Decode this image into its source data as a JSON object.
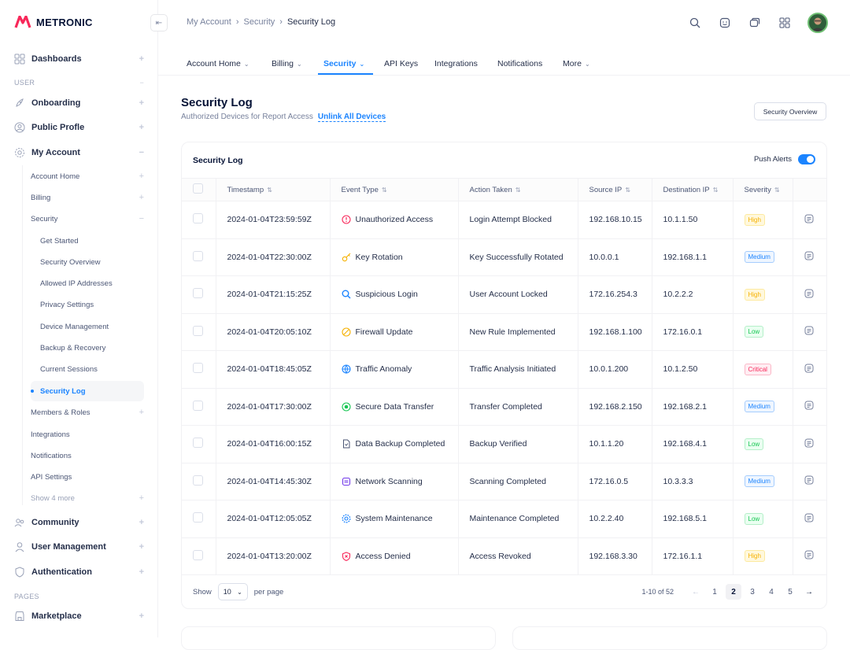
{
  "brand": {
    "name": "METRONIC",
    "accent": "#1b84ff",
    "logo_color": "#f8285a"
  },
  "sidebar": {
    "top": [
      {
        "label": "Dashboards",
        "icon": "grid-icon"
      }
    ],
    "group_user": "USER",
    "user_items": [
      {
        "label": "Onboarding",
        "icon": "rocket-icon"
      },
      {
        "label": "Public Profle",
        "icon": "user-circle-icon"
      },
      {
        "label": "My Account",
        "icon": "gear-icon"
      }
    ],
    "account_sub": [
      "Account Home",
      "Billing",
      "Security"
    ],
    "security_sub": [
      "Get Started",
      "Security Overview",
      "Allowed IP Addresses",
      "Privacy Settings",
      "Device Management",
      "Backup & Recovery",
      "Current Sessions",
      "Security Log"
    ],
    "account_sub2": [
      "Members & Roles",
      "Integrations",
      "Notifications",
      "API Settings",
      "Show 4 more"
    ],
    "more_items": [
      {
        "label": "Community",
        "icon": "users-icon"
      },
      {
        "label": "User Management",
        "icon": "user-icon"
      },
      {
        "label": "Authentication",
        "icon": "shield-icon"
      }
    ],
    "group_pages": "PAGES",
    "pages_items": [
      {
        "label": "Marketplace",
        "icon": "shop-icon"
      }
    ]
  },
  "breadcrumb": [
    "My Account",
    "Security",
    "Security Log"
  ],
  "tabs": [
    "Account Home",
    "Billing",
    "Security",
    "API Keys",
    "Integrations",
    "Notifications",
    "More"
  ],
  "page": {
    "title": "Security Log",
    "subtitle": "Authorized Devices for Report Access",
    "link": "Unlink All Devices",
    "overview_button": "Security Overview"
  },
  "card": {
    "title": "Security Log",
    "push_label": "Push Alerts",
    "columns": [
      "Timestamp",
      "Event Type",
      "Action Taken",
      "Source IP",
      "Destination IP",
      "Severity"
    ],
    "rows": [
      {
        "ts": "2024-01-04T23:59:59Z",
        "event": "Unauthorized Access",
        "icon": "alert-icon",
        "icolor": "#f8285a",
        "action": "Login Attempt Blocked",
        "src": "192.168.10.15",
        "dst": "10.1.1.50",
        "sev": "High"
      },
      {
        "ts": "2024-01-04T22:30:00Z",
        "event": "Key Rotation",
        "icon": "key-icon",
        "icolor": "#f6b100",
        "action": "Key Successfully Rotated",
        "src": "10.0.0.1",
        "dst": "192.168.1.1",
        "sev": "Medium"
      },
      {
        "ts": "2024-01-04T21:15:25Z",
        "event": "Suspicious Login",
        "icon": "search-icon",
        "icolor": "#1b84ff",
        "action": "User Account Locked",
        "src": "172.16.254.3",
        "dst": "10.2.2.2",
        "sev": "High"
      },
      {
        "ts": "2024-01-04T20:05:10Z",
        "event": "Firewall Update",
        "icon": "flame-icon",
        "icolor": "#f6b100",
        "action": "New Rule Implemented",
        "src": "192.168.1.100",
        "dst": "172.16.0.1",
        "sev": "Low"
      },
      {
        "ts": "2024-01-04T18:45:05Z",
        "event": "Traffic Anomaly",
        "icon": "globe-icon",
        "icolor": "#1b84ff",
        "action": "Traffic Analysis Initiated",
        "src": "10.0.1.200",
        "dst": "10.1.2.50",
        "sev": "Critical"
      },
      {
        "ts": "2024-01-04T17:30:00Z",
        "event": "Secure Data Transfer",
        "icon": "transfer-icon",
        "icolor": "#17c653",
        "action": "Transfer Completed",
        "src": "192.168.2.150",
        "dst": "192.168.2.1",
        "sev": "Medium"
      },
      {
        "ts": "2024-01-04T16:00:15Z",
        "event": "Data Backup Completed",
        "icon": "file-icon",
        "icolor": "#4b5675",
        "action": "Backup Verified",
        "src": "10.1.1.20",
        "dst": "192.168.4.1",
        "sev": "Low"
      },
      {
        "ts": "2024-01-04T14:45:30Z",
        "event": "Network Scanning",
        "icon": "scan-icon",
        "icolor": "#7239ea",
        "action": "Scanning Completed",
        "src": "172.16.0.5",
        "dst": "10.3.3.3",
        "sev": "Medium"
      },
      {
        "ts": "2024-01-04T12:05:05Z",
        "event": "System Maintenance",
        "icon": "cog-icon",
        "icolor": "#1b84ff",
        "action": "Maintenance Completed",
        "src": "10.2.2.40",
        "dst": "192.168.5.1",
        "sev": "Low"
      },
      {
        "ts": "2024-01-04T13:20:00Z",
        "event": "Access Denied",
        "icon": "shield-x-icon",
        "icolor": "#f8285a",
        "action": "Access Revoked",
        "src": "192.168.3.30",
        "dst": "172.16.1.1",
        "sev": "High"
      }
    ],
    "footer": {
      "show": "Show",
      "per_page_value": "10",
      "per_page": "per page",
      "range": "1-10 of 52",
      "pages": [
        "1",
        "2",
        "3",
        "4",
        "5"
      ],
      "current": "2"
    }
  }
}
